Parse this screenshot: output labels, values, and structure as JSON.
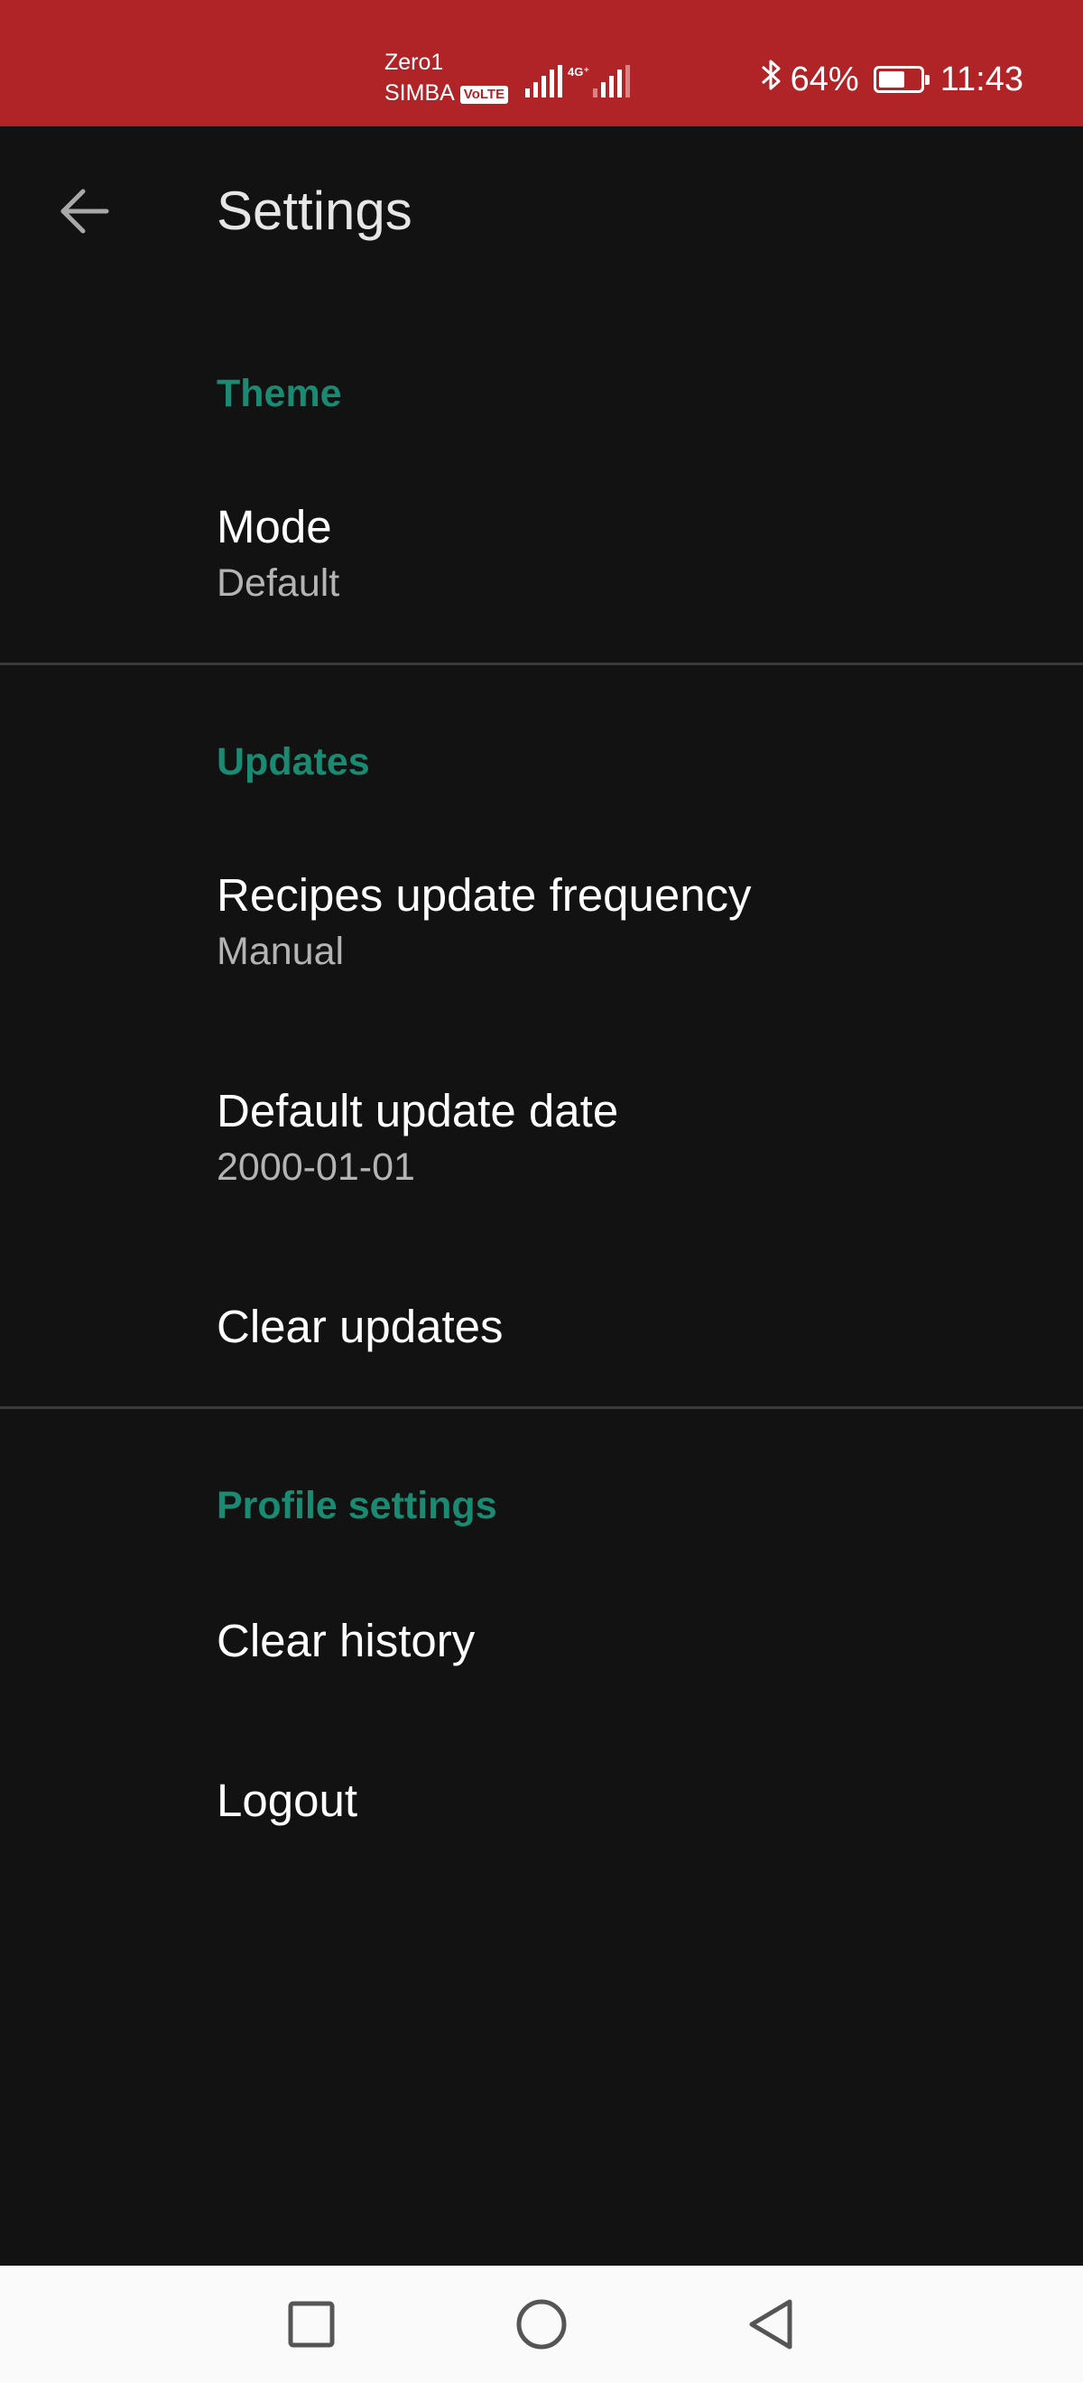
{
  "status_bar": {
    "carrier_1": "Zero1",
    "carrier_2": "SIMBA",
    "volte": "VoLTE",
    "network_type": "4G⁺",
    "battery_percent": "64%",
    "battery_level": 0.64,
    "time": "11:43",
    "background_color": "#b02427"
  },
  "toolbar": {
    "title": "Settings",
    "back_icon": "arrow-back-icon"
  },
  "sections": {
    "theme": {
      "header": "Theme",
      "mode": {
        "title": "Mode",
        "summary": "Default"
      }
    },
    "updates": {
      "header": "Updates",
      "frequency": {
        "title": "Recipes update frequency",
        "summary": "Manual"
      },
      "default_date": {
        "title": "Default update date",
        "summary": "2000-01-01"
      },
      "clear": {
        "title": "Clear updates"
      }
    },
    "profile": {
      "header": "Profile settings",
      "clear_history": {
        "title": "Clear history"
      },
      "logout": {
        "title": "Logout"
      }
    }
  },
  "colors": {
    "accent": "#1a8a73",
    "background": "#121212",
    "divider": "#3a3a3a"
  },
  "nav_bar": {
    "icons": [
      "recent-apps-icon",
      "home-icon",
      "back-icon"
    ]
  }
}
